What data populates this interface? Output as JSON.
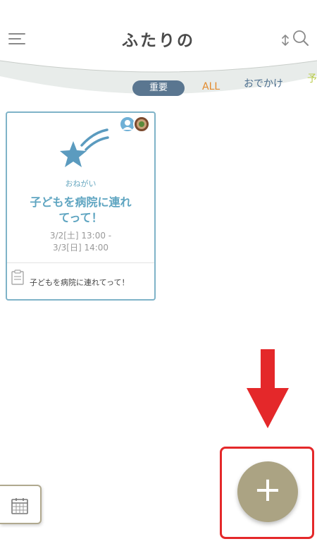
{
  "header": {
    "title": "ふたりの"
  },
  "tabs": [
    {
      "label": "重要",
      "active": true
    },
    {
      "label": "ALL",
      "color": "#e38a2c"
    },
    {
      "label": "おでかけ",
      "color": "#4d6f8f"
    },
    {
      "label": "予",
      "color": "#b9cc4a"
    }
  ],
  "card": {
    "category": "おねがい",
    "title": "子どもを病院に連れて って！",
    "title_lines": [
      "子どもを病院に連れ",
      "てって！"
    ],
    "date_start": "3/2[土] 13:00 -",
    "date_end": "3/3[日] 14:00",
    "memo": "子どもを病院に連れてって！",
    "icon": "shooting-star-icon",
    "accent_color": "#7fb3c8"
  },
  "fab": {
    "label": "+",
    "color": "#aba383"
  },
  "annotation": {
    "arrow_color": "#e4282a",
    "highlight_color": "#e4282a"
  },
  "calendar_button": {
    "icon": "calendar-icon"
  }
}
